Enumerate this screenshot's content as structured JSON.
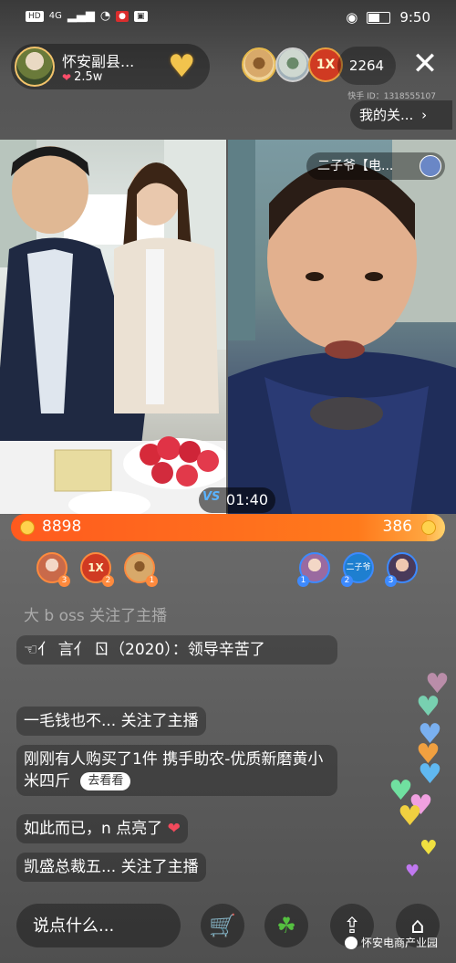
{
  "status_bar": {
    "left_items": [
      "HD",
      "4G"
    ],
    "time": "9:50"
  },
  "host": {
    "name": "怀安副县...",
    "likes": "2.5w"
  },
  "viewers": {
    "count": "2264",
    "avatar_badge_text": "1X"
  },
  "kuaishou_id": "快手 ID：1318555107",
  "my_follow": "我的关...",
  "pk": {
    "opponent_name": "二子爷【电...",
    "timer": "01:40",
    "vs_label": "VS",
    "left_score": "8898",
    "right_score": "386",
    "left_fraction": 0.958
  },
  "ranks_left": [
    {
      "num": "3"
    },
    {
      "num": "2",
      "text": "1X"
    },
    {
      "num": "1"
    }
  ],
  "ranks_right": [
    {
      "num": "1"
    },
    {
      "num": "2",
      "text": "二子爷"
    },
    {
      "num": "3"
    }
  ],
  "chat": {
    "faded": "大 b oss 关注了主播",
    "messages": [
      {
        "text": "☜亻 言亻 ㄖ（2020）：领导辛苦了"
      },
      {
        "text": "一毛钱也不... 关注了主播"
      },
      {
        "text": "刚刚有人购买了1件 携手助农-优质新磨黄小米四斤",
        "button": "去看看"
      },
      {
        "text": "如此而已，n 点亮了"
      },
      {
        "text": "凯盛总裁五... 关注了主播"
      }
    ]
  },
  "input": {
    "placeholder": "说点什么..."
  },
  "watermark": "怀安电商产业园",
  "colors": {
    "pk_left": "#ff5a1f",
    "pk_right": "#ffd36b",
    "like_heart": "#ff4d6a"
  },
  "icons": [
    "eye-icon",
    "battery-icon",
    "close-icon",
    "cart-icon",
    "clover-icon",
    "share-icon",
    "gift-icon"
  ]
}
